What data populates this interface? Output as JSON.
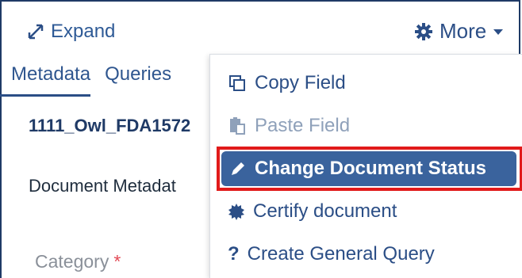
{
  "header": {
    "expand_label": "Expand",
    "more_label": "More"
  },
  "tabs": [
    {
      "label": "Metadata",
      "active": true
    },
    {
      "label": "Queries",
      "active": false
    }
  ],
  "document": {
    "name": "1111_Owl_FDA1572",
    "section_label": "Document Metadat",
    "category_label": "Category",
    "required_marker": "*"
  },
  "menu": {
    "items": [
      {
        "label": "Copy Field",
        "icon": "copy-icon",
        "disabled": false
      },
      {
        "label": "Paste Field",
        "icon": "paste-icon",
        "disabled": true
      },
      {
        "label": "Change Document Status",
        "icon": "pencil-icon",
        "highlighted": true
      },
      {
        "label": "Certify document",
        "icon": "certificate-icon",
        "disabled": false
      },
      {
        "label": "Create General Query",
        "icon": "question-icon",
        "disabled": false
      }
    ]
  },
  "colors": {
    "primary": "#2b4e86",
    "highlight_bg": "#3a639d",
    "highlight_border": "#e11a1a",
    "required": "#e24a56"
  }
}
